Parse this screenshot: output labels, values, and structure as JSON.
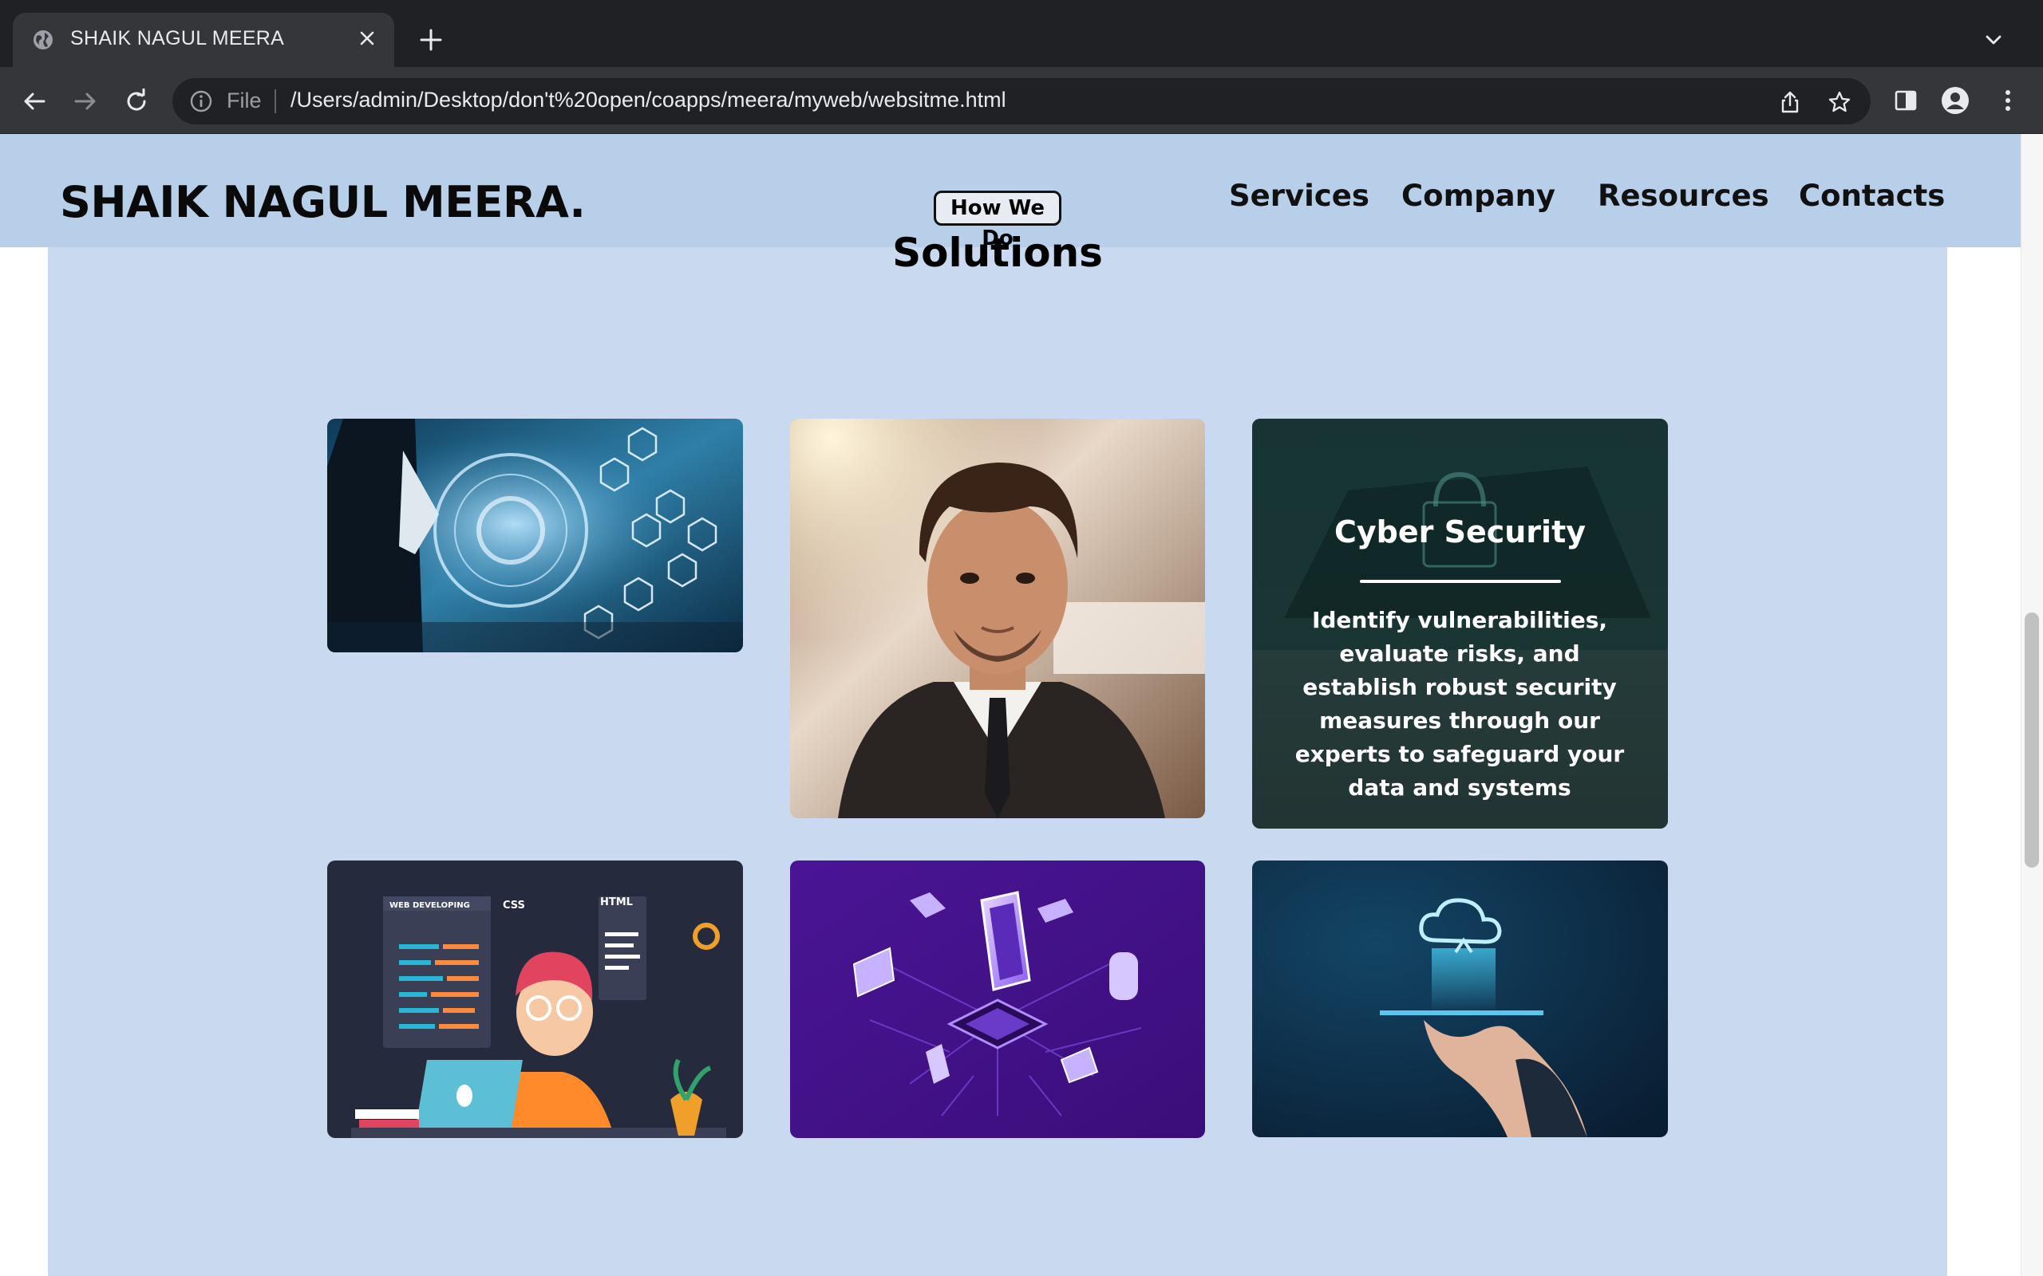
{
  "browser": {
    "tab_title": "SHAIK NAGUL MEERA",
    "address_scheme": "File",
    "address_url": "/Users/admin/Desktop/don't%20open/coapps/meera/myweb/websitme.html"
  },
  "site": {
    "logo": "SHAIK NAGUL MEERA.",
    "nav": [
      "Services",
      "Company",
      "Resources",
      "Contacts"
    ]
  },
  "section": {
    "badge": "How We Do",
    "title": "Solutions"
  },
  "cards": [
    {
      "name": "digital-business-card",
      "image": "businessman-tablet-digital-icons"
    },
    {
      "name": "portrait-card",
      "image": "man-in-suit-portrait"
    },
    {
      "name": "cyber-security-card",
      "title": "Cyber Security",
      "description": "Identify vulnerabilities, evaluate risks, and establish robust security measures through our experts to safeguard your data and systems"
    },
    {
      "name": "web-developing-card",
      "image": "web-developer-illustration",
      "labels": [
        "WEB DEVELOPING",
        "CSS",
        "HTML"
      ]
    },
    {
      "name": "iot-card",
      "image": "isometric-iot-chip-devices"
    },
    {
      "name": "cloud-card",
      "image": "hand-holding-cloud"
    }
  ],
  "colors": {
    "header_bg": "#b8cfea",
    "content_bg": "#c9daf0",
    "chrome_dark": "#202124",
    "chrome_toolbar": "#35363a"
  }
}
